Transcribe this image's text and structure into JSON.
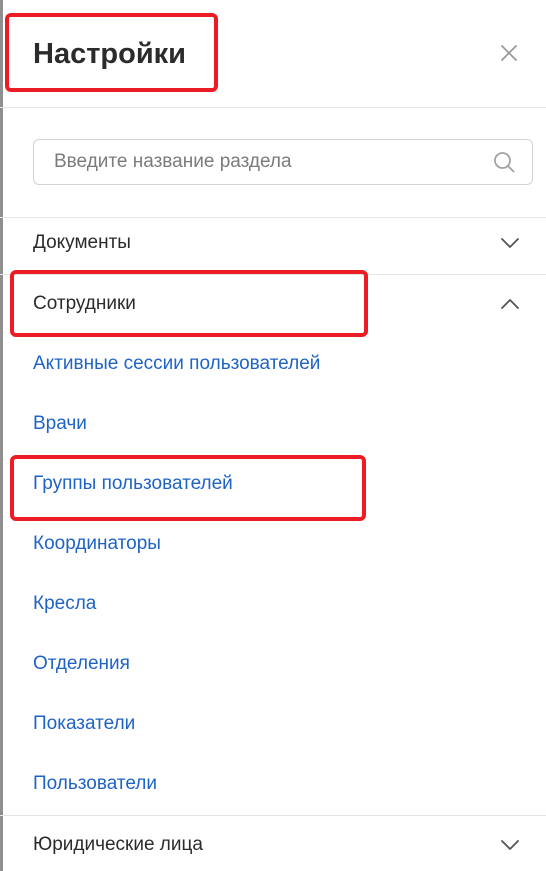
{
  "header": {
    "title": "Настройки"
  },
  "search": {
    "placeholder": "Введите название раздела",
    "value": ""
  },
  "sections": {
    "documents": {
      "label": "Документы",
      "expanded": false
    },
    "employees": {
      "label": "Сотрудники",
      "expanded": true,
      "items": [
        "Активные сессии пользователей",
        "Врачи",
        "Группы пользователей",
        "Координаторы",
        "Кресла",
        "Отделения",
        "Показатели",
        "Пользователи"
      ]
    },
    "legal": {
      "label": "Юридические лица",
      "expanded": false
    }
  },
  "colors": {
    "link": "#1e63c6",
    "text": "#2b2b2b",
    "highlight": "#ec1c24",
    "divider": "#e6e6e6"
  },
  "icons": {
    "close": "close-icon",
    "search": "search-icon",
    "collapsed": "chevron-down-icon",
    "expanded": "chevron-up-icon"
  }
}
